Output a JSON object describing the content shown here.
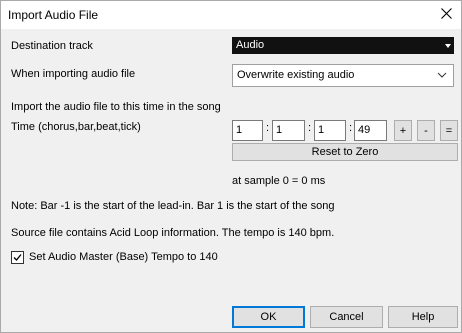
{
  "window": {
    "title": "Import Audio File",
    "close_icon": "close-icon"
  },
  "destination": {
    "label": "Destination track",
    "value": "Audio"
  },
  "importing": {
    "label": "When importing audio file",
    "value": "Overwrite existing audio"
  },
  "import_time": {
    "intro": "Import the audio file to this time in the song",
    "label": "Time (chorus,bar,beat,tick)",
    "chorus": "1",
    "bar": "1",
    "beat": "1",
    "tick": "49",
    "sep": ":",
    "plus_label": "+",
    "minus_label": "-",
    "equals_label": "=",
    "reset_label": "Reset to Zero",
    "sample_text": "at sample 0 = 0 ms"
  },
  "notes": {
    "leadin": "Note: Bar -1 is the start of the lead-in. Bar 1 is the start of the song",
    "source": "Source file contains Acid Loop information.  The tempo is 140 bpm."
  },
  "tempo_option": {
    "label": "Set Audio Master (Base) Tempo to 140",
    "checked": true
  },
  "buttons": {
    "ok": "OK",
    "cancel": "Cancel",
    "help": "Help"
  }
}
